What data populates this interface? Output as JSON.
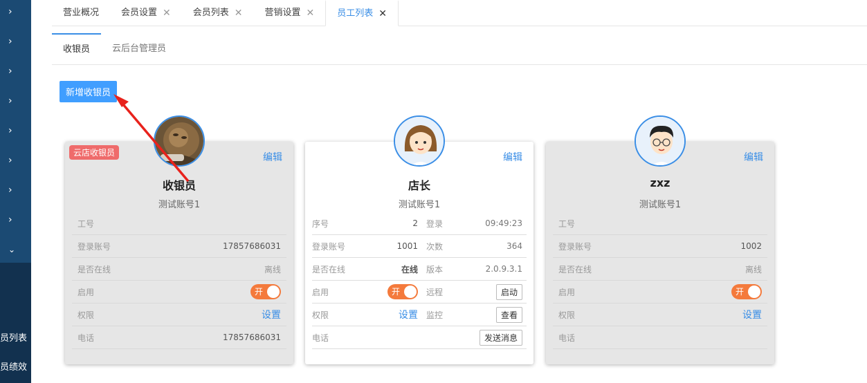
{
  "sidebar": {
    "labels": [
      "员列表",
      "员绩效"
    ]
  },
  "tabs": [
    {
      "label": "营业概况",
      "closable": false
    },
    {
      "label": "会员设置",
      "closable": true
    },
    {
      "label": "会员列表",
      "closable": true
    },
    {
      "label": "营销设置",
      "closable": true
    },
    {
      "label": "员工列表",
      "closable": true,
      "active": true
    }
  ],
  "close_glyph": "✕",
  "subtabs": [
    "收银员",
    "云后台管理员"
  ],
  "add_button": "新增收银员",
  "labels": {
    "edit": "编辑",
    "job_no": "工号",
    "serial": "序号",
    "login_account": "登录账号",
    "online": "是否在线",
    "enabled": "启用",
    "permission": "权限",
    "phone": "电话",
    "login": "登录",
    "count": "次数",
    "version": "版本",
    "remote": "远程",
    "monitor": "监控",
    "settings": "设置",
    "toggle_on": "开"
  },
  "cards": [
    {
      "badge": "云店收银员",
      "name": "收银员",
      "account": "测试账号1",
      "job_no": "",
      "login_account": "17857686031",
      "online_status": "离线",
      "phone": "17857686031"
    },
    {
      "name": "店长",
      "account": "测试账号1",
      "serial": "2",
      "login_account": "1001",
      "online_status": "在线",
      "login_time": "09:49:23",
      "login_count": "364",
      "version": "2.0.9.3.1",
      "remote_button": "启动",
      "monitor_button": "查看",
      "message_button": "发送消息",
      "phone": ""
    },
    {
      "name": "zxz",
      "account": "测试账号1",
      "job_no": "",
      "login_account": "1002",
      "online_status": "离线",
      "phone": ""
    }
  ]
}
